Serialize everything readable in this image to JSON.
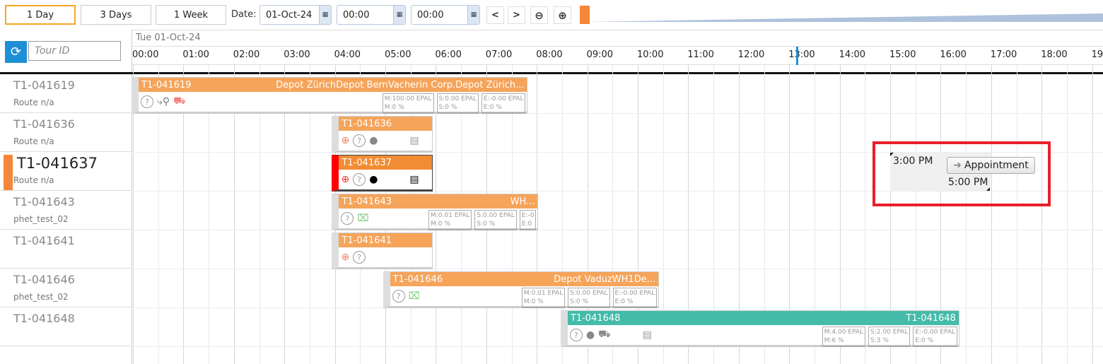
{
  "toolbar": {
    "range_buttons": [
      "1 Day",
      "3 Days",
      "1 Week"
    ],
    "active_range": "1 Day",
    "date_label": "Date:",
    "date_value": "01-Oct-24",
    "time_from": "00:00",
    "time_to": "00:00",
    "prev_label": "<",
    "next_label": ">",
    "zoom_out_icon": "zoom-out-icon",
    "zoom_in_icon": "zoom-in-icon",
    "slider_value_fraction": 0.0
  },
  "search": {
    "placeholder": "Tour ID",
    "icon": "search-go-icon"
  },
  "timeline": {
    "date_header": "Tue 01-Oct-24",
    "hours": [
      "00:00",
      "01:00",
      "02:00",
      "03:00",
      "04:00",
      "05:00",
      "06:00",
      "07:00",
      "08:00",
      "09:00",
      "10:00",
      "11:00",
      "12:00",
      "13:00",
      "14:00",
      "15:00",
      "16:00",
      "17:00",
      "18:00",
      "19"
    ],
    "current_time": "12:55"
  },
  "rows": [
    {
      "id": "T1-041619",
      "sub": "Route n/a"
    },
    {
      "id": "T1-041636",
      "sub": "Route n/a"
    },
    {
      "id": "T1-041637",
      "sub": "Route n/a",
      "selected": true
    },
    {
      "id": "T1-041643",
      "sub": "phet_test_02"
    },
    {
      "id": "T1-041641",
      "sub": ""
    },
    {
      "id": "T1-041646",
      "sub": "phet_test_02"
    },
    {
      "id": "T1-041648",
      "sub": ""
    }
  ],
  "tours": [
    {
      "id": "T1-041619",
      "right": "Depot ZürichDepot BernVacherin Corp.Depot Zürich...",
      "stats": [
        [
          "M:100.00 EPAL",
          "M:0 %"
        ],
        [
          "S:0.00 EPAL",
          "S:0 %"
        ],
        [
          "E:-0.00 EPAL",
          "E:0 %"
        ]
      ],
      "icons": [
        "question-icon",
        "route-icon",
        "forklift-icon"
      ],
      "color": "#f5a45a"
    },
    {
      "id": "T1-041636",
      "right": "",
      "stats": [],
      "icons": [
        "zoom-in-icon",
        "question-icon",
        "person-icon",
        "document-icon"
      ],
      "color": "#f5a45a"
    },
    {
      "id": "T1-041637",
      "right": "",
      "stats": [],
      "icons": [
        "zoom-in-icon",
        "question-icon",
        "person-icon",
        "document-icon"
      ],
      "color": "#f28c33"
    },
    {
      "id": "T1-041643",
      "right": "WH...",
      "stats": [
        [
          "M:0.01 EPAL",
          "M:0 %"
        ],
        [
          "S:0.00 EPAL",
          "S:0 %"
        ],
        [
          "E:-0",
          "E:0"
        ]
      ],
      "icons": [
        "question-icon",
        "pallet-icon"
      ],
      "color": "#f5a45a"
    },
    {
      "id": "T1-041641",
      "right": "",
      "stats": [],
      "icons": [
        "zoom-in-icon",
        "question-icon"
      ],
      "color": "#f5a45a"
    },
    {
      "id": "T1-041646",
      "right": "Depot VaduzWH1De...",
      "stats": [
        [
          "M:0.01 EPAL",
          "M:0 %"
        ],
        [
          "S:0.00 EPAL",
          "S:0 %"
        ],
        [
          "E:-0.00 EPAL",
          "E:0 %"
        ]
      ],
      "icons": [
        "question-icon",
        "pallet-icon"
      ],
      "color": "#f5a45a"
    },
    {
      "id": "T1-041648",
      "right": "T1-041648",
      "stats": [
        [
          "M:4.00 EPAL",
          "M:6 %"
        ],
        [
          "S:2.00 EPAL",
          "S:3 %"
        ],
        [
          "E:-0.00 EPAL",
          "E:0 %"
        ]
      ],
      "icons": [
        "question-icon",
        "person-icon",
        "truck-icon",
        "document-icon"
      ],
      "color": "#45bba9"
    }
  ],
  "appointment": {
    "start": "3:00 PM",
    "end": "5:00 PM",
    "button": "Appointment",
    "highlight_color": "#e8202a"
  }
}
